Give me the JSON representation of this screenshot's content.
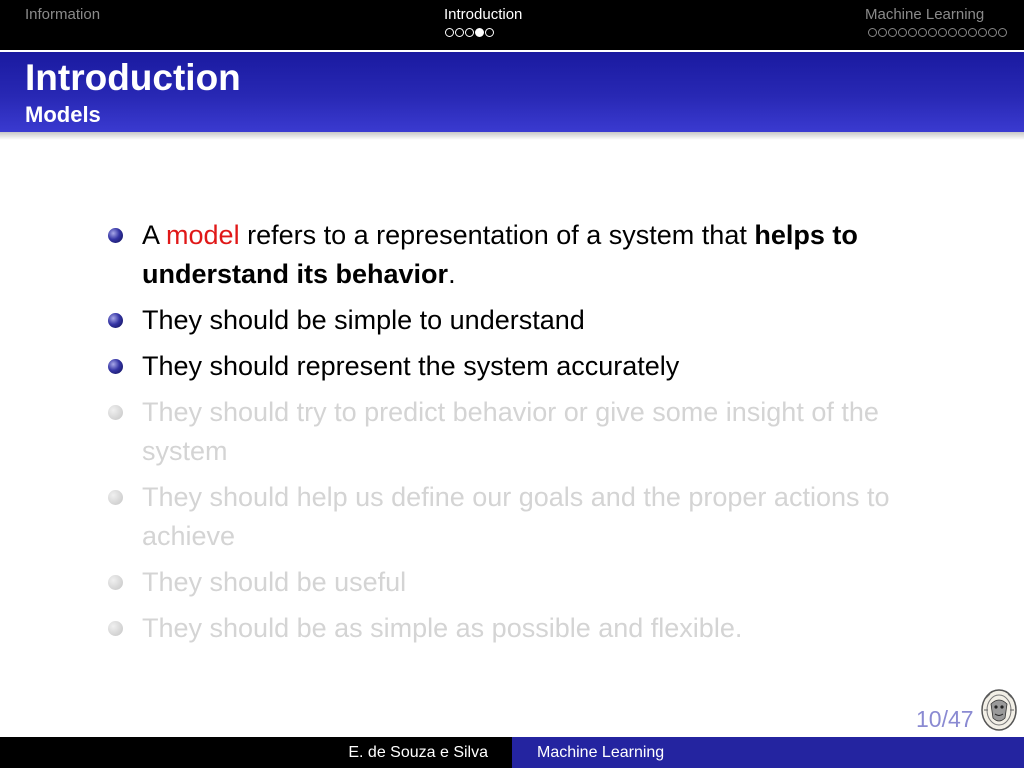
{
  "nav": {
    "sections": [
      {
        "label": "Information"
      },
      {
        "label": "Introduction",
        "dots_total": 5,
        "current_dot": 4
      },
      {
        "label": "Machine Learning",
        "dots_total": 14
      }
    ]
  },
  "frame": {
    "title": "Introduction",
    "subtitle": "Models"
  },
  "bullets": [
    {
      "parts": [
        {
          "text": "A ",
          "style": "normal"
        },
        {
          "text": "model",
          "style": "keyword"
        },
        {
          "text": " refers to a representation of a system that ",
          "style": "normal"
        },
        {
          "text": "helps to understand its behavior",
          "style": "bold"
        },
        {
          "text": ".",
          "style": "normal"
        }
      ],
      "visible": true
    },
    {
      "parts": [
        {
          "text": "They should be simple to understand",
          "style": "normal"
        }
      ],
      "visible": true
    },
    {
      "parts": [
        {
          "text": "They should represent the system accurately",
          "style": "normal"
        }
      ],
      "visible": true
    },
    {
      "parts": [
        {
          "text": "They should try to predict behavior or give some insight of the system",
          "style": "normal"
        }
      ],
      "visible": false
    },
    {
      "parts": [
        {
          "text": "They should help us define our goals and the proper actions to achieve",
          "style": "normal"
        }
      ],
      "visible": false
    },
    {
      "parts": [
        {
          "text": "They should be useful",
          "style": "normal"
        }
      ],
      "visible": false
    },
    {
      "parts": [
        {
          "text": "They should be as simple as possible and flexible.",
          "style": "normal"
        }
      ],
      "visible": false
    }
  ],
  "page_number": "10/47",
  "footer": {
    "author": "E. de Souza e Silva",
    "title": "Machine Learning"
  },
  "colors": {
    "keyword": "#e01818",
    "title_bar": "#2828b4",
    "faded_text": "#d4d4d4"
  }
}
